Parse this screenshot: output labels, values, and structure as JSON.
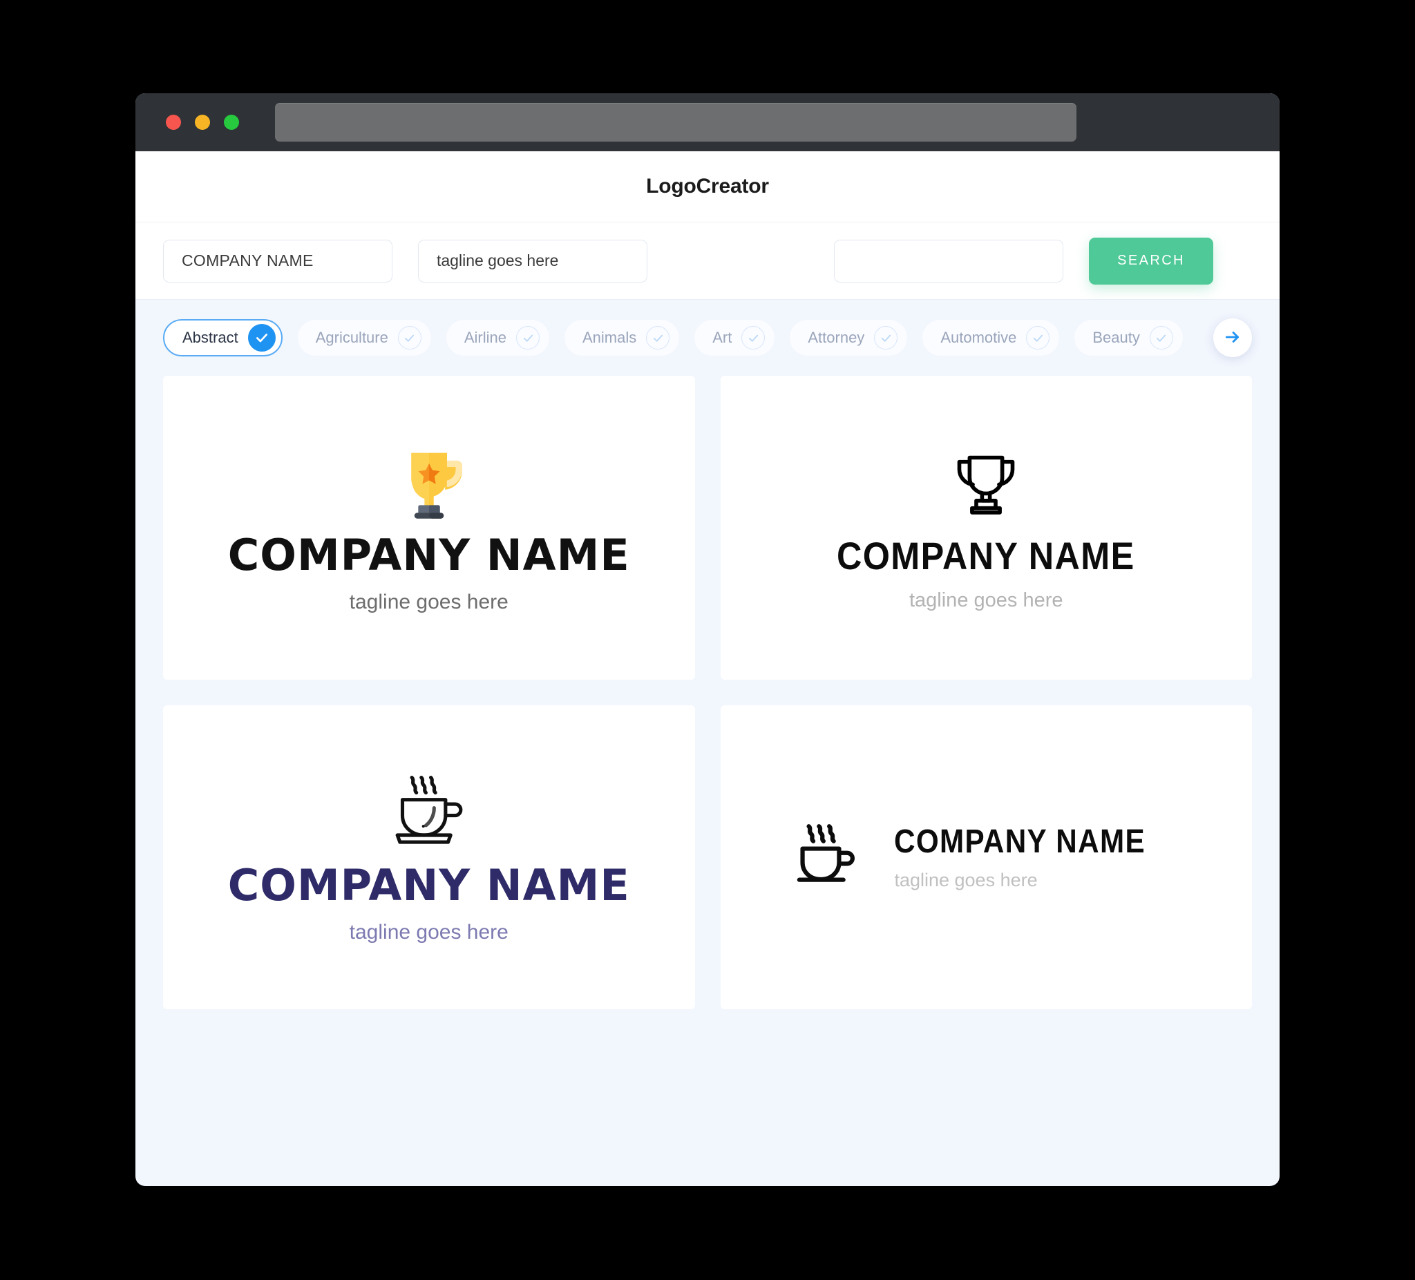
{
  "window": {
    "traffic_lights": [
      {
        "name": "close",
        "color": "#f7564f"
      },
      {
        "name": "minimize",
        "color": "#f7b526"
      },
      {
        "name": "maximize",
        "color": "#27c93f"
      }
    ],
    "address_bar_value": "",
    "address_bar_placeholder": ""
  },
  "header": {
    "title": "LogoCreator"
  },
  "search": {
    "company_name_value": "COMPANY NAME",
    "company_name_placeholder": "COMPANY NAME",
    "tagline_value": "tagline goes here",
    "tagline_placeholder": "tagline goes here",
    "third_value": "",
    "third_placeholder": "",
    "search_label": "SEARCH",
    "accent_color": "#4fc997"
  },
  "categories": {
    "selected": "Abstract",
    "accent_color": "#1f93f2",
    "next_arrow_label": "→",
    "items": [
      {
        "label": "Abstract",
        "selected": true
      },
      {
        "label": "Agriculture",
        "selected": false
      },
      {
        "label": "Airline",
        "selected": false
      },
      {
        "label": "Animals",
        "selected": false
      },
      {
        "label": "Art",
        "selected": false
      },
      {
        "label": "Attorney",
        "selected": false
      },
      {
        "label": "Automotive",
        "selected": false
      },
      {
        "label": "Beauty",
        "selected": false
      }
    ]
  },
  "results": {
    "cards": [
      {
        "icon": "trophy-solid-icon",
        "name": "COMPANY NAME",
        "tagline": "tagline goes here",
        "name_color": "#111111",
        "tagline_color": "#6d6d6d",
        "layout": "stacked"
      },
      {
        "icon": "trophy-outline-icon",
        "name": "COMPANY NAME",
        "tagline": "tagline goes here",
        "name_color": "#0c0c0c",
        "tagline_color": "#b3b3b3",
        "layout": "stacked"
      },
      {
        "icon": "coffee-cup-outline-icon",
        "name": "COMPANY NAME",
        "tagline": "tagline goes here",
        "name_color": "#2e2b68",
        "tagline_color": "#7c7ab0",
        "layout": "stacked"
      },
      {
        "icon": "coffee-cup-outline-icon",
        "name": "COMPANY NAME",
        "tagline": "tagline goes here",
        "name_color": "#0c0c0c",
        "tagline_color": "#c0c0c0",
        "layout": "horizontal"
      }
    ]
  }
}
